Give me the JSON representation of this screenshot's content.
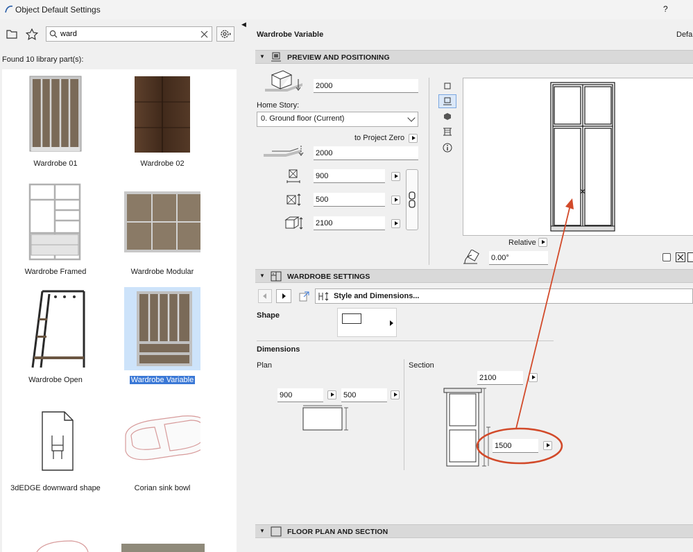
{
  "window": {
    "title": "Object Default Settings",
    "help": "?"
  },
  "left": {
    "search_value": "ward",
    "found_text": "Found 10 library part(s):",
    "items": [
      {
        "label": "Wardrobe 01"
      },
      {
        "label": "Wardrobe 02"
      },
      {
        "label": "Wardrobe Framed"
      },
      {
        "label": "Wardrobe Modular"
      },
      {
        "label": "Wardrobe Open"
      },
      {
        "label": "Wardrobe Variable"
      },
      {
        "label": "3dEDGE downward shape"
      },
      {
        "label": "Corian sink bowl"
      }
    ]
  },
  "right": {
    "title": "Wardrobe Variable",
    "default_label": "Defa",
    "preview_section": "PREVIEW AND POSITIONING",
    "elevation_value": "2000",
    "home_story_label": "Home Story:",
    "home_story_value": "0. Ground floor (Current)",
    "to_project_zero": "to Project Zero",
    "project_zero_value": "2000",
    "width_value": "900",
    "depth_value": "500",
    "height_value": "2100",
    "relative_label": "Relative",
    "rotation_value": "0.00°",
    "wardrobe_section": "WARDROBE SETTINGS",
    "page_selector": "Style and Dimensions...",
    "shape_label": "Shape",
    "dimensions_label": "Dimensions",
    "plan_label": "Plan",
    "section_label": "Section",
    "plan_width": "900",
    "plan_depth": "500",
    "section_height": "2100",
    "section_split": "1500",
    "floor_section": "FLOOR PLAN AND SECTION"
  },
  "colors": {
    "annotation": "#d24a2a",
    "selection": "#3a78d6",
    "section_bar": "#d9d9d9"
  }
}
